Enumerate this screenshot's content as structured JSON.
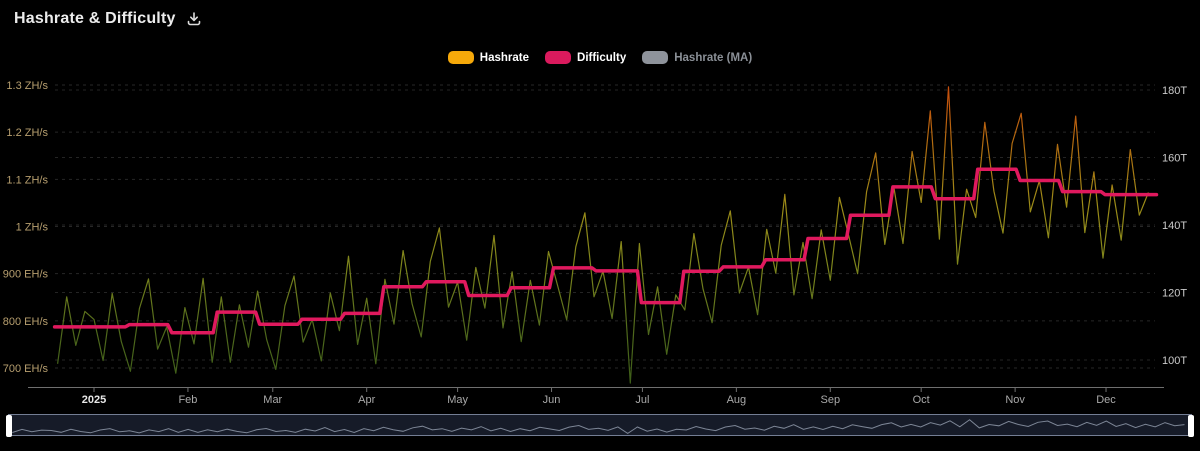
{
  "header": {
    "title": "Hashrate & Difficulty"
  },
  "legend": [
    {
      "id": "hashrate",
      "label": "Hashrate",
      "color": "#f6a90a",
      "text_color": "#ffffff",
      "active": true
    },
    {
      "id": "difficulty",
      "label": "Difficulty",
      "color": "#da1a5d",
      "text_color": "#ffffff",
      "active": true
    },
    {
      "id": "hashrate-ma",
      "label": "Hashrate (MA)",
      "color": "#8e939b",
      "text_color": "#8b9097",
      "active": false
    }
  ],
  "chart_data": {
    "type": "line",
    "title": "Hashrate & Difficulty",
    "x_axis": {
      "unit": "month",
      "ticks": [
        {
          "label": "2025",
          "day": 0,
          "emph": true
        },
        {
          "label": "Feb",
          "day": 31,
          "emph": false
        },
        {
          "label": "Mar",
          "day": 59,
          "emph": false
        },
        {
          "label": "Apr",
          "day": 90,
          "emph": false
        },
        {
          "label": "May",
          "day": 120,
          "emph": false
        },
        {
          "label": "Jun",
          "day": 151,
          "emph": false
        },
        {
          "label": "Jul",
          "day": 181,
          "emph": false
        },
        {
          "label": "Aug",
          "day": 212,
          "emph": false
        },
        {
          "label": "Sep",
          "day": 243,
          "emph": false
        },
        {
          "label": "Oct",
          "day": 273,
          "emph": false
        },
        {
          "label": "Nov",
          "day": 304,
          "emph": false
        },
        {
          "label": "Dec",
          "day": 334,
          "emph": false
        }
      ],
      "day_range": [
        -13,
        350
      ]
    },
    "y_axis_left": {
      "name": "Hashrate",
      "unit": "EH/s",
      "ticks": [
        {
          "label": "1.3 ZH/s",
          "value": 1300
        },
        {
          "label": "1.2 ZH/s",
          "value": 1200
        },
        {
          "label": "1.1 ZH/s",
          "value": 1100
        },
        {
          "label": "1 ZH/s",
          "value": 1000
        },
        {
          "label": "900 EH/s",
          "value": 900
        },
        {
          "label": "800 EH/s",
          "value": 800
        },
        {
          "label": "700 EH/s",
          "value": 700
        }
      ],
      "range": [
        700,
        1300
      ],
      "grid": "dashed"
    },
    "y_axis_right": {
      "name": "Difficulty",
      "unit": "T",
      "ticks": [
        {
          "label": "180T",
          "value": 180
        },
        {
          "label": "160T",
          "value": 160
        },
        {
          "label": "140T",
          "value": 140
        },
        {
          "label": "120T",
          "value": 120
        },
        {
          "label": "100T",
          "value": 100
        }
      ],
      "range": [
        100,
        180
      ],
      "grid": "dashed"
    },
    "series": [
      {
        "name": "Hashrate",
        "axis": "left",
        "unit": "EH/s",
        "style": "noisy-line",
        "gradient_stops": [
          "#c94a0c",
          "#b26b10",
          "#9c8c18",
          "#7c851c",
          "#50691c",
          "#3a5c18"
        ],
        "points": [
          [
            -12,
            709
          ],
          [
            -9,
            851
          ],
          [
            -6,
            748
          ],
          [
            -3,
            820
          ],
          [
            0,
            803
          ],
          [
            3,
            716
          ],
          [
            6,
            858
          ],
          [
            9,
            756
          ],
          [
            12,
            693
          ],
          [
            15,
            826
          ],
          [
            18,
            889
          ],
          [
            21,
            740
          ],
          [
            24,
            787
          ],
          [
            27,
            689
          ],
          [
            30,
            828
          ],
          [
            33,
            751
          ],
          [
            36,
            890
          ],
          [
            39,
            712
          ],
          [
            42,
            851
          ],
          [
            45,
            712
          ],
          [
            48,
            834
          ],
          [
            51,
            744
          ],
          [
            54,
            863
          ],
          [
            57,
            760
          ],
          [
            60,
            697
          ],
          [
            63,
            832
          ],
          [
            66,
            895
          ],
          [
            69,
            755
          ],
          [
            72,
            803
          ],
          [
            75,
            715
          ],
          [
            78,
            859
          ],
          [
            81,
            779
          ],
          [
            84,
            937
          ],
          [
            87,
            750
          ],
          [
            90,
            848
          ],
          [
            93,
            709
          ],
          [
            96,
            888
          ],
          [
            99,
            793
          ],
          [
            102,
            949
          ],
          [
            105,
            836
          ],
          [
            108,
            766
          ],
          [
            111,
            926
          ],
          [
            114,
            997
          ],
          [
            117,
            829
          ],
          [
            120,
            882
          ],
          [
            123,
            759
          ],
          [
            126,
            913
          ],
          [
            129,
            827
          ],
          [
            132,
            981
          ],
          [
            135,
            785
          ],
          [
            138,
            904
          ],
          [
            141,
            756
          ],
          [
            144,
            886
          ],
          [
            147,
            791
          ],
          [
            150,
            947
          ],
          [
            153,
            875
          ],
          [
            156,
            802
          ],
          [
            159,
            957
          ],
          [
            162,
            1029
          ],
          [
            165,
            851
          ],
          [
            168,
            905
          ],
          [
            171,
            805
          ],
          [
            174,
            968
          ],
          [
            177,
            668
          ],
          [
            180,
            964
          ],
          [
            183,
            771
          ],
          [
            186,
            872
          ],
          [
            189,
            729
          ],
          [
            192,
            855
          ],
          [
            195,
            823
          ],
          [
            198,
            985
          ],
          [
            201,
            868
          ],
          [
            204,
            796
          ],
          [
            207,
            960
          ],
          [
            210,
            1033
          ],
          [
            213,
            859
          ],
          [
            216,
            914
          ],
          [
            219,
            813
          ],
          [
            222,
            994
          ],
          [
            225,
            901
          ],
          [
            228,
            1068
          ],
          [
            231,
            855
          ],
          [
            234,
            966
          ],
          [
            237,
            847
          ],
          [
            240,
            993
          ],
          [
            243,
            886
          ],
          [
            246,
            1062
          ],
          [
            249,
            982
          ],
          [
            252,
            900
          ],
          [
            255,
            1074
          ],
          [
            258,
            1156
          ],
          [
            261,
            962
          ],
          [
            264,
            1083
          ],
          [
            267,
            964
          ],
          [
            270,
            1159
          ],
          [
            273,
            1051
          ],
          [
            276,
            1245
          ],
          [
            279,
            973
          ],
          [
            282,
            1296
          ],
          [
            285,
            920
          ],
          [
            288,
            1079
          ],
          [
            291,
            1019
          ],
          [
            294,
            1221
          ],
          [
            297,
            1075
          ],
          [
            300,
            986
          ],
          [
            303,
            1176
          ],
          [
            306,
            1240
          ],
          [
            309,
            1031
          ],
          [
            312,
            1097
          ],
          [
            315,
            976
          ],
          [
            318,
            1174
          ],
          [
            321,
            1041
          ],
          [
            324,
            1234
          ],
          [
            327,
            987
          ],
          [
            330,
            1116
          ],
          [
            333,
            933
          ],
          [
            336,
            1088
          ],
          [
            339,
            971
          ],
          [
            342,
            1163
          ],
          [
            345,
            1024
          ],
          [
            348,
            1072
          ]
        ]
      },
      {
        "name": "Difficulty",
        "axis": "right",
        "unit": "T",
        "style": "step-line",
        "color": "#e0195e",
        "points": [
          [
            -13,
            109.8
          ],
          [
            11,
            110.5
          ],
          [
            25,
            108.1
          ],
          [
            40,
            114.2
          ],
          [
            54,
            110.6
          ],
          [
            68,
            112.1
          ],
          [
            82,
            113.8
          ],
          [
            95,
            121.7
          ],
          [
            109,
            123.2
          ],
          [
            123,
            119.1
          ],
          [
            137,
            121.4
          ],
          [
            151,
            127.3
          ],
          [
            165,
            126.4
          ],
          [
            180,
            117.0
          ],
          [
            194,
            126.3
          ],
          [
            207,
            127.6
          ],
          [
            221,
            129.7
          ],
          [
            235,
            136.0
          ],
          [
            249,
            142.9
          ],
          [
            263,
            151.3
          ],
          [
            277,
            147.8
          ],
          [
            291,
            156.5
          ],
          [
            305,
            153.2
          ],
          [
            319,
            149.9
          ],
          [
            333,
            149.0
          ],
          [
            350,
            149.0
          ]
        ]
      },
      {
        "name": "Hashrate (MA)",
        "axis": "left",
        "unit": "EH/s",
        "style": "line",
        "color": "#8e939b",
        "hidden": true,
        "points": []
      }
    ]
  },
  "navigator": {
    "sparkline_color": "#7d8696"
  }
}
